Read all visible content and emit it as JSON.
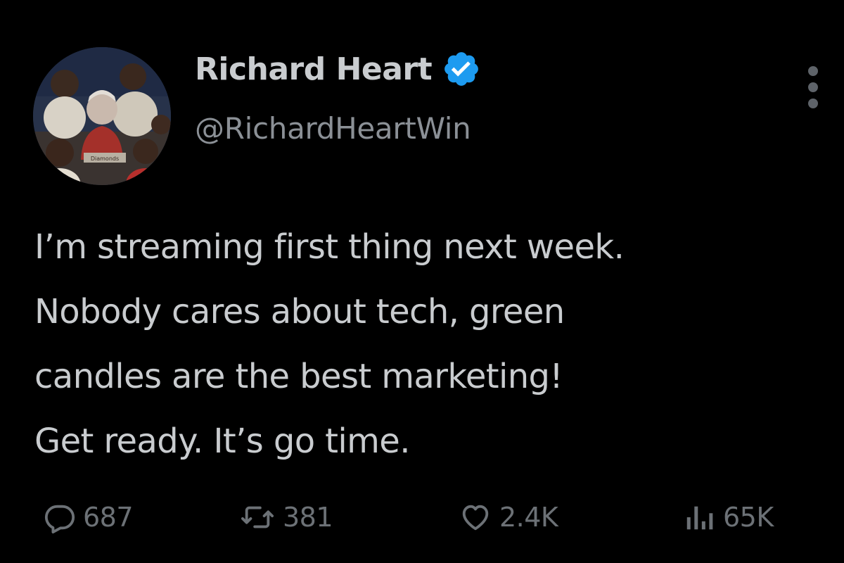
{
  "tweet": {
    "author": {
      "display_name": "Richard Heart",
      "handle": "@RichardHeartWin",
      "verified": true,
      "avatar_caption": "Diamonds"
    },
    "text_lines": [
      "I’m streaming first thing next week.",
      "Nobody cares about tech, green",
      "candles are the best marketing!",
      "Get ready. It’s go time."
    ],
    "metrics": {
      "replies": "687",
      "retweets": "381",
      "likes": "2.4K",
      "views": "65K"
    }
  },
  "icons": {
    "verified": "verified-badge-icon",
    "more": "more-options-icon",
    "reply": "reply-icon",
    "retweet": "retweet-icon",
    "like": "heart-icon",
    "views": "views-bar-chart-icon"
  },
  "colors": {
    "background": "#000000",
    "text_primary": "#c9cccf",
    "text_secondary": "#8b9096",
    "metric_text": "#6c7176",
    "verified_blue": "#1d9bf0"
  }
}
